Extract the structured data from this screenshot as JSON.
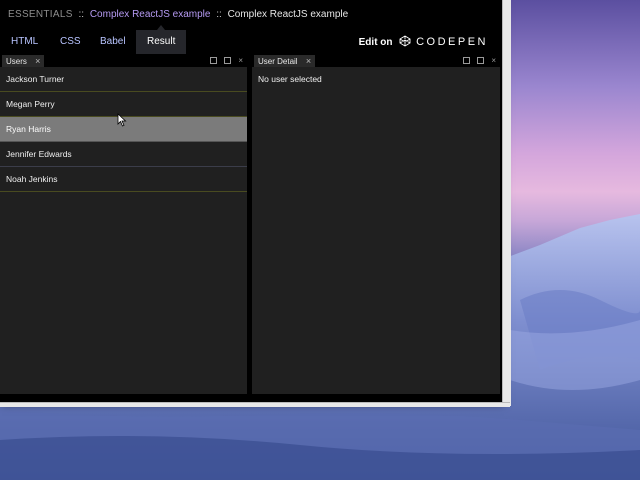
{
  "titlebar": {
    "section": "ESSENTIALS",
    "separator": "::",
    "link_title": "Complex ReactJS example",
    "plain_title": "Complex ReactJS example"
  },
  "tabs": [
    {
      "label": "HTML"
    },
    {
      "label": "CSS"
    },
    {
      "label": "Babel"
    },
    {
      "label": "Result",
      "active": true
    }
  ],
  "edit_on": {
    "label": "Edit on",
    "brand": "CODEPEN"
  },
  "users_panel": {
    "tab_label": "Users",
    "close_glyph": "×",
    "users": [
      {
        "name": "Jackson Turner"
      },
      {
        "name": "Megan Perry"
      },
      {
        "name": "Ryan Harris",
        "selected": true
      },
      {
        "name": "Jennifer Edwards"
      },
      {
        "name": "Noah Jenkins"
      }
    ]
  },
  "detail_panel": {
    "tab_label": "User Detail",
    "close_glyph": "×",
    "empty_text": "No user selected"
  },
  "colors": {
    "link": "#b59af2",
    "selected_row": "#7b7b7b",
    "row_divider": "#494b20"
  },
  "icons": [
    "popout-icon",
    "maximize-icon",
    "close-icon",
    "codepen-logo-icon",
    "mouse-cursor-icon"
  ]
}
